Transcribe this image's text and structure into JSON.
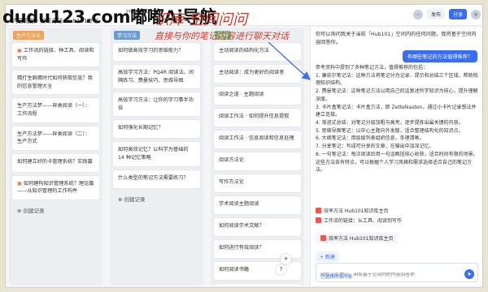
{
  "app": {
    "window_title": "Hub101",
    "breadcrumb": "内容概览 · 效率方法 Hub101专栏"
  },
  "toolbar": {
    "publish": "发布",
    "share": "分享",
    "kb_btn": "知识库"
  },
  "columns": [
    {
      "tag": "生产方法论",
      "tag_color": "#f0a35a",
      "count": "",
      "cards": [
        {
          "text": "工作流的链接、种工具、阅读和写作",
          "icon": true
        },
        {
          "text": "精打生僻鹰时代如何获取信息？我的信息管理大全"
        },
        {
          "text": "生产方法梦——异类阅读（一）：工作流程"
        },
        {
          "text": "生产方法梦——异类阅读（二）：生产方式"
        },
        {
          "text": "如何建立好的卡管理系统？实践篇"
        },
        {
          "text": "如何建构知识管理系统？理论篇——从知识管理的工作构件",
          "icon": true
        }
      ],
      "add_label": "创建记录"
    },
    {
      "tag": "学习方法",
      "tag_color": "#6c9bd2",
      "count": "",
      "cards": [
        {
          "text": "如何做高效学习的思维能力？"
        },
        {
          "text": "高效学习方法：PQ4R 阅读法、间隔练习、费曼技巧、思维导图"
        },
        {
          "text": "高效学习方法：让你的学习事半功倍"
        },
        {
          "text": "如何强化长期记忆？"
        },
        {
          "text": "如何高效记忆？以科学为基础的 14 种记忆策略"
        },
        {
          "text": "什么类型的笔记方法需要练习？"
        }
      ],
      "add_label": "创建记录"
    },
    {
      "tag": "读物",
      "tag_color": "#7ec089",
      "count": "",
      "cards": [
        {
          "text": "主动阅读的结构化方法"
        },
        {
          "text": "主动阅读：成为更好的阅读者"
        },
        {
          "text": "阅读之道 · 主题阅读"
        },
        {
          "text": "阅读工作法 · 如何提升信息提取"
        },
        {
          "text": "阅读工作法 · 信息阅读和信息处理"
        },
        {
          "text": "阅读方法论"
        },
        {
          "text": "写作方法论"
        },
        {
          "text": "学术阅读主题阅读"
        },
        {
          "text": "如何阅读学术文献？"
        },
        {
          "text": "如何进行有效阅读？"
        },
        {
          "text": "如何阅读书籍"
        },
        {
          "text": "阅读如何读书"
        }
      ],
      "add_label": ""
    }
  ],
  "chat": {
    "intro": "你可以询问我关于当前「Hub101」空间内的任何问题，我将基于空间内容回答你。",
    "user_question": "有哪些笔记的方法值得推荐？",
    "answer_lines": [
      "参考资料中提到了多种笔记方法，值得推荐的包括：",
      "1. 康奈尔笔记法：这种方法将笔记分为记录、提示和总结三个区域，帮助梳理知识结构。",
      "2. 费曼笔记法：这种笔记方法以用自己的话复述所学知识为核心，提升理解深度。",
      "3. 卡片盒笔记法：卡片盒方法，即 Zettelkasten，通过小卡片记录想法并建立连接。",
      "4. 渐进式总结：对笔记分层加粗与高亮，逐步提炼出最关键的内容。",
      "5. 思维导图笔记：以中心主题向外发散，适合整理结构化的知识点。",
      "6. 大纲笔记法：用层级列表组织信息，条理清晰。",
      "7. 分享笔记：写成可分享的文章，在输出中加深记忆。",
      "8. 一句笔记法：每次阅读后用一句话概括核心收获，适合时间有限的场景。",
      "这些方法各有特点，可以根据个人学习风格和需求选择适合自己的笔记方法。"
    ],
    "refs": [
      "效率方法 Hub101知识库主页",
      "工作流的链接：从工具、阅读到写作"
    ],
    "source_chip": "效率方法 Hub101知识库主页",
    "new_label": "+ 新建",
    "input_placeholder": "向知识库提问，AI将基于空间内的内容回答你",
    "pick_kb": "已选择所有内容"
  },
  "overlay": {
    "watermark": "dudu123.com嘟嘟Ai导航",
    "title": "识库-空间问问",
    "subtitle": "直接与你的笔记内容进行聊天对话",
    "color": "#d33a2c",
    "arrow_color": "#3a6cf4"
  }
}
